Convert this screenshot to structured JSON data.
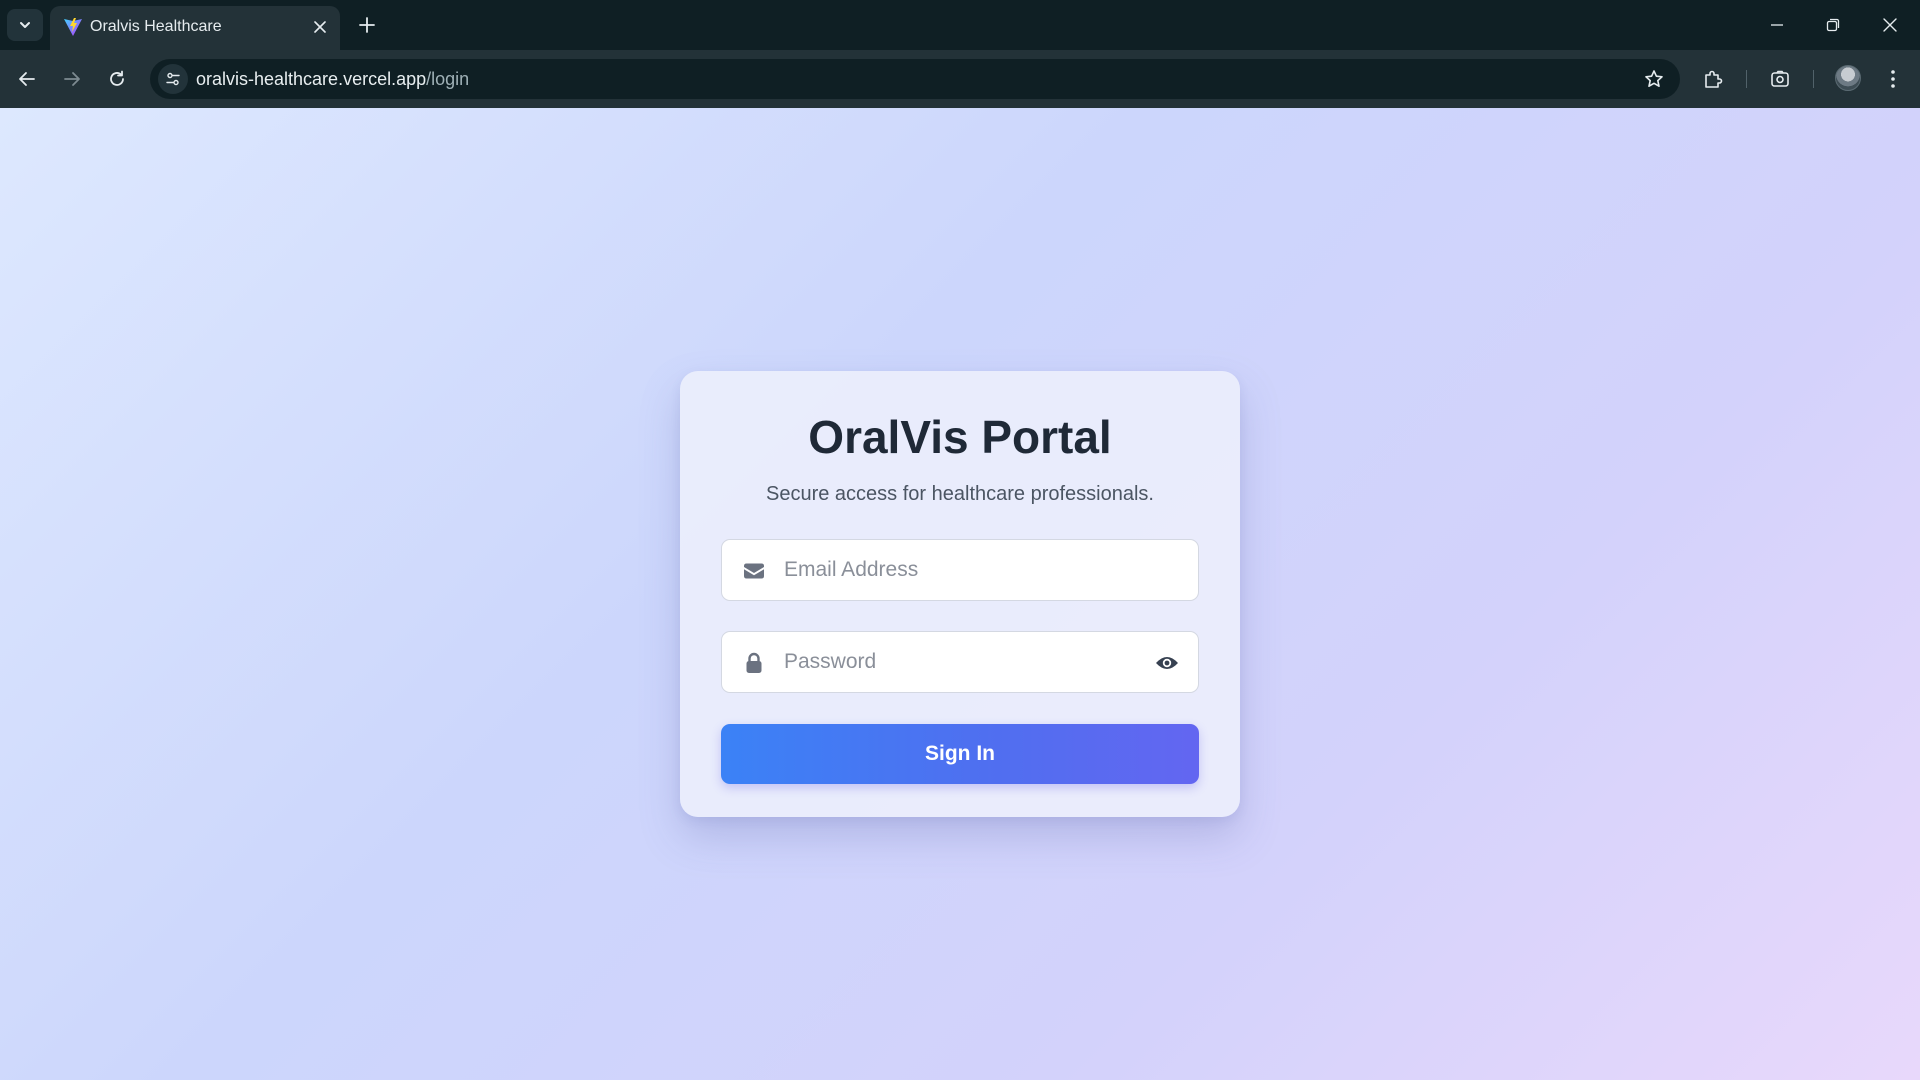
{
  "browser": {
    "tab": {
      "title": "Oralvis Healthcare",
      "favicon": "vite-logo-icon"
    },
    "url": {
      "host": "oralvis-healthcare.vercel.app",
      "path": "/login"
    },
    "icons": {
      "tab_search": "chevron-down-icon",
      "close_tab": "close-icon",
      "new_tab": "plus-icon",
      "back": "arrow-left-icon",
      "forward": "arrow-right-icon",
      "reload": "reload-icon",
      "site_info": "tune-icon",
      "bookmark": "star-icon",
      "extensions": "puzzle-icon",
      "lens": "screenshot-icon",
      "profile": "avatar",
      "menu": "kebab-menu-icon",
      "minimize": "minimize-icon",
      "restore": "restore-icon",
      "close_window": "close-icon"
    }
  },
  "login": {
    "title": "OralVis Portal",
    "subtitle": "Secure access for healthcare professionals.",
    "email_placeholder": "Email Address",
    "password_placeholder": "Password",
    "submit_label": "Sign In"
  },
  "colors": {
    "chrome_dark": "#0f1f24",
    "chrome_toolbar": "#233238",
    "title_text": "#1f2937",
    "button_gradient_start": "#3b82f6",
    "button_gradient_end": "#6366f1",
    "page_gradient_start": "#dde8fe",
    "page_gradient_end": "#e8d8fb"
  }
}
